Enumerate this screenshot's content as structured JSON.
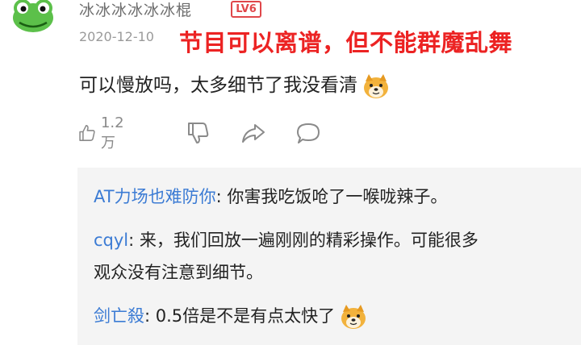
{
  "comment": {
    "username": "冰冰冰冰冰冰棍",
    "level": "LV6",
    "date": "2020-12-10",
    "content": "可以慢放吗，太多细节了我没看清",
    "content_emoji": "doge-emoji",
    "likes": "1.2万"
  },
  "overlay_caption": "节目可以离谱，但不能群魔乱舞",
  "replies": [
    {
      "user": "AT力场也难防你",
      "sep": ": ",
      "text": "你害我吃饭呛了一喉咙辣子。"
    },
    {
      "user": "cqyl",
      "sep": ": ",
      "text": "来，我们回放一遍刚刚的精彩操作。可能很多",
      "text2": "观众没有注意到细节。"
    },
    {
      "user": "剑亡殺",
      "sep": ": ",
      "text": "0.5倍是不是有点太快了",
      "emoji": "doge-emoji"
    }
  ],
  "icons": {
    "avatar": "frog-avatar",
    "like": "thumbs-up-icon",
    "dislike": "thumbs-down-icon",
    "share": "share-arrow-icon",
    "reply": "comment-bubble-icon"
  },
  "colors": {
    "username_gray": "#6d6d6d",
    "level_red": "#e0474a",
    "overlay_red": "#ec2323",
    "reply_user_blue": "#3b7bd4",
    "reply_bg": "#f4f4f4"
  }
}
